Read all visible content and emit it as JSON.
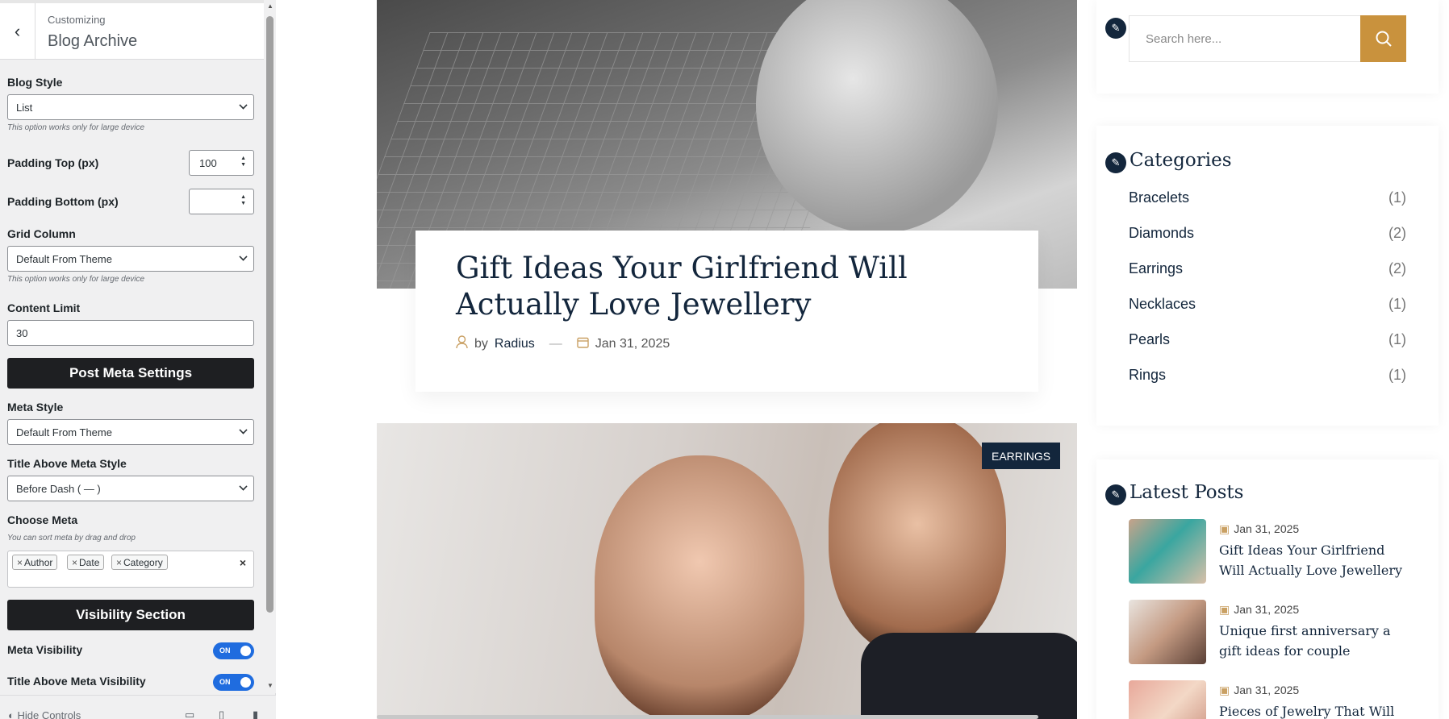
{
  "customizer": {
    "back_label": "‹",
    "header_subtitle": "Customizing",
    "header_title": "Blog Archive",
    "blog_style": {
      "label": "Blog Style",
      "value": "List",
      "note": "This option works only for large device"
    },
    "padding_top": {
      "label": "Padding Top (px)",
      "value": "100"
    },
    "padding_bottom": {
      "label": "Padding Bottom (px)",
      "value": ""
    },
    "grid_column": {
      "label": "Grid Column",
      "value": "Default From Theme",
      "note": "This option works only for large device"
    },
    "content_limit": {
      "label": "Content Limit",
      "value": "30"
    },
    "post_meta_settings_label": "Post Meta Settings",
    "meta_style": {
      "label": "Meta Style",
      "value": "Default From Theme"
    },
    "title_above_meta_style": {
      "label": "Title Above Meta Style",
      "value": "Before Dash ( — )"
    },
    "choose_meta": {
      "label": "Choose Meta",
      "note": "You can sort meta by drag and drop",
      "tags": [
        "Author",
        "Date",
        "Category"
      ],
      "clear": "×"
    },
    "visibility_section_label": "Visibility Section",
    "meta_visibility": {
      "label": "Meta Visibility",
      "state": "ON"
    },
    "title_above_meta_visibility": {
      "label": "Title Above Meta Visibility",
      "state": "ON"
    },
    "footer": {
      "hide_controls": "Hide Controls"
    }
  },
  "preview": {
    "post": {
      "title": "Gift Ideas Your Girlfriend Will Actually Love Jewellery",
      "by": "by",
      "author": "Radius",
      "separator": "—",
      "date": "Jan 31, 2025"
    },
    "second_post_badge": "EARRINGS",
    "search": {
      "placeholder": "Search here..."
    },
    "categories": {
      "title": "Categories",
      "items": [
        {
          "name": "Bracelets",
          "count": "(1)"
        },
        {
          "name": "Diamonds",
          "count": "(2)"
        },
        {
          "name": "Earrings",
          "count": "(2)"
        },
        {
          "name": "Necklaces",
          "count": "(1)"
        },
        {
          "name": "Pearls",
          "count": "(1)"
        },
        {
          "name": "Rings",
          "count": "(1)"
        }
      ]
    },
    "latest_posts": {
      "title": "Latest Posts",
      "items": [
        {
          "date": "Jan 31, 2025",
          "title": "Gift Ideas Your Girlfriend Will Actually Love Jewellery"
        },
        {
          "date": "Jan 31, 2025",
          "title": "Unique first anniversary a gift ideas for couple"
        },
        {
          "date": "Jan 31, 2025",
          "title": "Pieces of Jewelry That Will"
        }
      ]
    }
  },
  "colors": {
    "accent_gold": "#c9923d",
    "navy": "#13263c",
    "toggle_blue": "#1f6cdf"
  }
}
